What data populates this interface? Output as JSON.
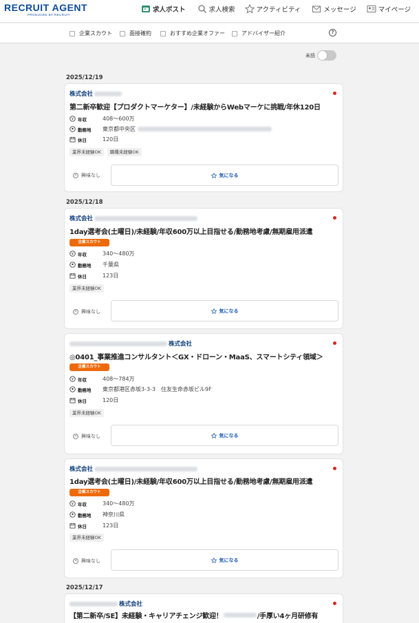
{
  "header": {
    "logo_main": "RECRUIT AGENT",
    "logo_sub": "PRODUCED BY RECRUIT",
    "nav": [
      {
        "label": "求人ポスト",
        "icon": "job-post-icon",
        "active": true
      },
      {
        "label": "求人検索",
        "icon": "search-icon",
        "active": false
      },
      {
        "label": "アクティビティ",
        "icon": "star-icon",
        "active": false
      },
      {
        "label": "メッセージ",
        "icon": "message-icon",
        "active": false
      },
      {
        "label": "マイページ",
        "icon": "id-card-icon",
        "active": false
      }
    ]
  },
  "filters": [
    {
      "label": "企業スカウト"
    },
    {
      "label": "面接確約"
    },
    {
      "label": "おすすめ企業オファー"
    },
    {
      "label": "アドバイザー紹介"
    }
  ],
  "help_icon": "?",
  "toggle": {
    "label": "未読",
    "on": false
  },
  "dates": [
    "2025/12/19",
    "2025/12/18",
    "2025/12/17"
  ],
  "card_labels": {
    "salary": "年収",
    "location": "勤務地",
    "holidays": "休日",
    "not_interested": "興味なし",
    "interested": "気になる"
  },
  "cards": [
    {
      "company": "株式会社",
      "title": "第二新卒歓迎【プロダクトマーケター】/未経験からWebマーケに挑戦/年休120日",
      "badge": "",
      "salary": "408～600万",
      "location": "東京都中央区",
      "holidays": "120日",
      "tags": [
        "業界未経験OK",
        "職種未経験OK"
      ]
    },
    {
      "company": "株式会社",
      "title": "1day選考会(土曜日)/未経験/年収600万以上目指せる/勤務地考慮/無期雇用派遣",
      "badge": "企業スカウト",
      "salary": "340～480万",
      "location": "千葉県",
      "holidays": "123日",
      "tags": [
        "業界未経験OK"
      ]
    },
    {
      "company": "株式会社",
      "title": "◎0401_事業推進コンサルタント＜GX・ドローン・MaaS、スマートシティ領域＞",
      "badge": "企業スカウト",
      "salary": "408～784万",
      "location": "東京都港区赤坂3-3-3　住友生命赤坂ビル9F",
      "holidays": "120日",
      "tags": [
        "業界未経験OK"
      ]
    },
    {
      "company": "株式会社",
      "title": "1day選考会(土曜日)/未経験/年収600万以上目指せる/勤務地考慮/無期雇用派遣",
      "badge": "企業スカウト",
      "salary": "340～480万",
      "location": "神奈川県",
      "holidays": "123日",
      "tags": [
        "業界未経験OK"
      ]
    },
    {
      "company": "株式会社",
      "title": "【第二新卒/SE】未経験・キャリアチェンジ歓迎！",
      "title_suffix": "/手厚い4ヶ月研修有",
      "badge": "",
      "salary": "",
      "location": "",
      "holidays": "",
      "tags": []
    }
  ],
  "colors": {
    "brand": "#0b4a9a",
    "badge": "#ed6a0c",
    "unread_dot": "#d6281f",
    "link": "#1d5bb5"
  }
}
